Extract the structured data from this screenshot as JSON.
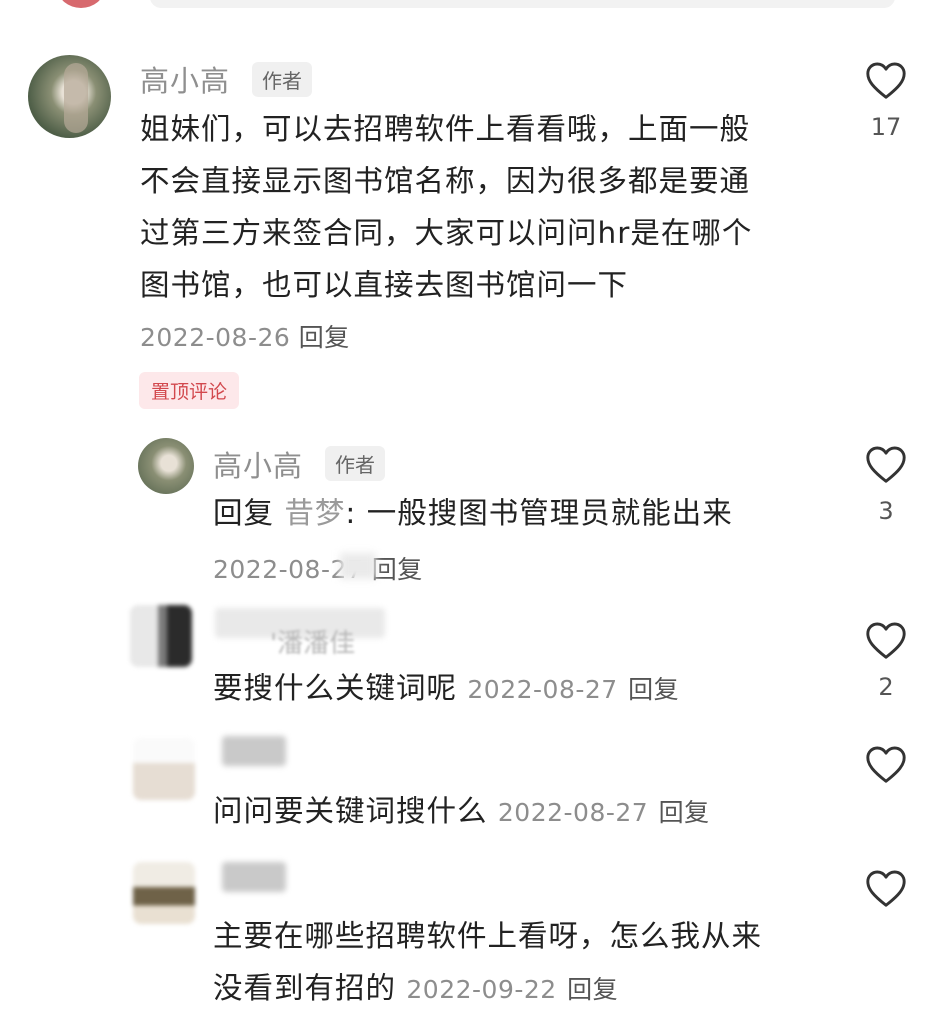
{
  "comments": [
    {
      "author": "高小高",
      "badge": "作者",
      "lines": [
        "姐妹们，可以去招聘软件上看看哦，上面一般",
        "不会直接显示图书馆名称，因为很多都是要通",
        "过第三方来签合同，大家可以问问hr是在哪个",
        "图书馆，也可以直接去图书馆问一下"
      ],
      "date": "2022-08-26",
      "reply_label": "回复",
      "likes": "17",
      "pinned_label": "置顶评论"
    },
    {
      "author": "高小高",
      "badge": "作者",
      "prefix": "回复",
      "reply_to": "昔梦",
      "text": ": 一般搜图书管理员就能出来",
      "date": "2022-08-27",
      "reply_label": "回复",
      "likes": "3"
    },
    {
      "author_fragment": "'潘潘佳",
      "text": "要搜什么关键词呢",
      "date": "2022-08-27",
      "reply_label": "回复",
      "likes": "2"
    },
    {
      "text": "问问要关键词搜什么",
      "date": "2022-08-27",
      "reply_label": "回复"
    },
    {
      "lines": [
        "主要在哪些招聘软件上看呀，怎么我从来",
        "没看到有招的"
      ],
      "date": "2022-09-22",
      "reply_label": "回复"
    }
  ],
  "icons": {
    "like": "heart-outline-icon"
  },
  "colors": {
    "pinned_bg": "#fde8ea",
    "pinned_text": "#d2484d",
    "muted": "#8d8d8d"
  }
}
